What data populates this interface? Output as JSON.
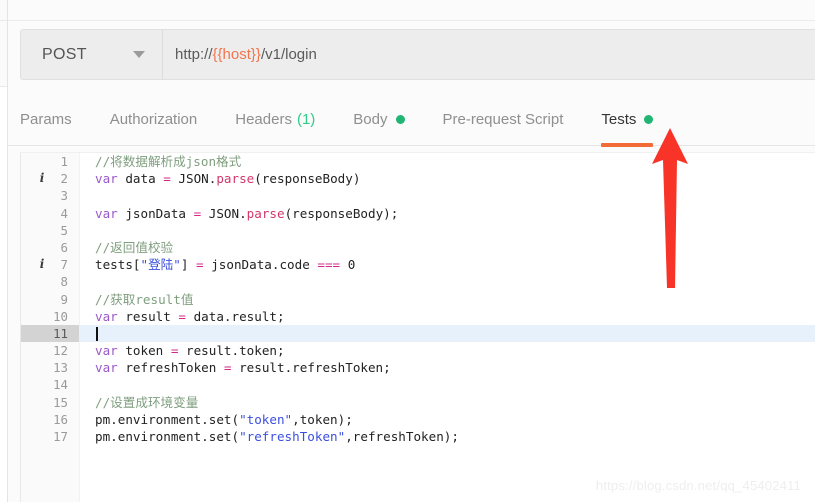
{
  "request": {
    "method": "POST",
    "method_caret_icon": "chevron-down-icon",
    "url_prefix": "http://",
    "url_variable": "{{host}}",
    "url_suffix": "/v1/login",
    "url_full": "http://{{host}}/v1/login"
  },
  "tabs": [
    {
      "label": "Params",
      "count": "",
      "dot": false,
      "active": false
    },
    {
      "label": "Authorization",
      "count": "",
      "dot": false,
      "active": false
    },
    {
      "label": "Headers",
      "count": "(1)",
      "dot": false,
      "active": false
    },
    {
      "label": "Body",
      "count": "",
      "dot": true,
      "active": false
    },
    {
      "label": "Pre-request Script",
      "count": "",
      "dot": false,
      "active": false
    },
    {
      "label": "Tests",
      "count": "",
      "dot": true,
      "active": true
    }
  ],
  "editor": {
    "lines": [
      {
        "n": "1",
        "marker": "",
        "active": false,
        "tokens": [
          {
            "t": "com",
            "s": "//将数据解析成json格式"
          }
        ]
      },
      {
        "n": "2",
        "marker": "i",
        "active": false,
        "tokens": [
          {
            "t": "kw",
            "s": "var"
          },
          {
            "t": "pln",
            "s": " data "
          },
          {
            "t": "op",
            "s": "="
          },
          {
            "t": "pln",
            "s": " JSON."
          },
          {
            "t": "fn",
            "s": "parse"
          },
          {
            "t": "pln",
            "s": "(responseBody)"
          }
        ]
      },
      {
        "n": "3",
        "marker": "",
        "active": false,
        "tokens": []
      },
      {
        "n": "4",
        "marker": "",
        "active": false,
        "tokens": [
          {
            "t": "kw",
            "s": "var"
          },
          {
            "t": "pln",
            "s": " jsonData "
          },
          {
            "t": "op",
            "s": "="
          },
          {
            "t": "pln",
            "s": " JSON."
          },
          {
            "t": "fn",
            "s": "parse"
          },
          {
            "t": "pln",
            "s": "(responseBody);"
          }
        ]
      },
      {
        "n": "5",
        "marker": "",
        "active": false,
        "tokens": []
      },
      {
        "n": "6",
        "marker": "",
        "active": false,
        "tokens": [
          {
            "t": "com",
            "s": "//返回值校验"
          }
        ]
      },
      {
        "n": "7",
        "marker": "i",
        "active": false,
        "tokens": [
          {
            "t": "pln",
            "s": "tests["
          },
          {
            "t": "str",
            "s": "\"登陆\""
          },
          {
            "t": "pln",
            "s": "] "
          },
          {
            "t": "op",
            "s": "="
          },
          {
            "t": "pln",
            "s": " jsonData.code "
          },
          {
            "t": "op",
            "s": "==="
          },
          {
            "t": "pln",
            "s": " 0"
          }
        ]
      },
      {
        "n": "8",
        "marker": "",
        "active": false,
        "tokens": []
      },
      {
        "n": "9",
        "marker": "",
        "active": false,
        "tokens": [
          {
            "t": "com",
            "s": "//获取result值"
          }
        ]
      },
      {
        "n": "10",
        "marker": "",
        "active": false,
        "tokens": [
          {
            "t": "kw",
            "s": "var"
          },
          {
            "t": "pln",
            "s": " result "
          },
          {
            "t": "op",
            "s": "="
          },
          {
            "t": "pln",
            "s": " data.result;"
          }
        ]
      },
      {
        "n": "11",
        "marker": "",
        "active": true,
        "tokens": []
      },
      {
        "n": "12",
        "marker": "",
        "active": false,
        "tokens": [
          {
            "t": "kw",
            "s": "var"
          },
          {
            "t": "pln",
            "s": " token "
          },
          {
            "t": "op",
            "s": "="
          },
          {
            "t": "pln",
            "s": " result.token;"
          }
        ]
      },
      {
        "n": "13",
        "marker": "",
        "active": false,
        "tokens": [
          {
            "t": "kw",
            "s": "var"
          },
          {
            "t": "pln",
            "s": " refreshToken "
          },
          {
            "t": "op",
            "s": "="
          },
          {
            "t": "pln",
            "s": " result.refreshToken;"
          }
        ]
      },
      {
        "n": "14",
        "marker": "",
        "active": false,
        "tokens": []
      },
      {
        "n": "15",
        "marker": "",
        "active": false,
        "tokens": [
          {
            "t": "com",
            "s": "//设置成环境变量"
          }
        ]
      },
      {
        "n": "16",
        "marker": "",
        "active": false,
        "tokens": [
          {
            "t": "pln",
            "s": "pm.environment.set("
          },
          {
            "t": "str",
            "s": "\"token\""
          },
          {
            "t": "pln",
            "s": ",token);"
          }
        ]
      },
      {
        "n": "17",
        "marker": "",
        "active": false,
        "tokens": [
          {
            "t": "pln",
            "s": "pm.environment.set("
          },
          {
            "t": "str",
            "s": "\"refreshToken\""
          },
          {
            "t": "pln",
            "s": ",refreshToken);"
          }
        ]
      }
    ],
    "cursor_line": "11"
  },
  "annotation": {
    "arrow_icon": "up-arrow-annotation",
    "arrow_color": "#f83429",
    "points_at": "Tests"
  },
  "watermark": {
    "text": "https://blog.csdn.net/qq_45402411"
  },
  "colors": {
    "accent_orange": "#f26a35",
    "dot_green": "#21b573",
    "count_green": "#2ecc88",
    "url_variable": "#f2754c",
    "arrow_red": "#f83429"
  }
}
